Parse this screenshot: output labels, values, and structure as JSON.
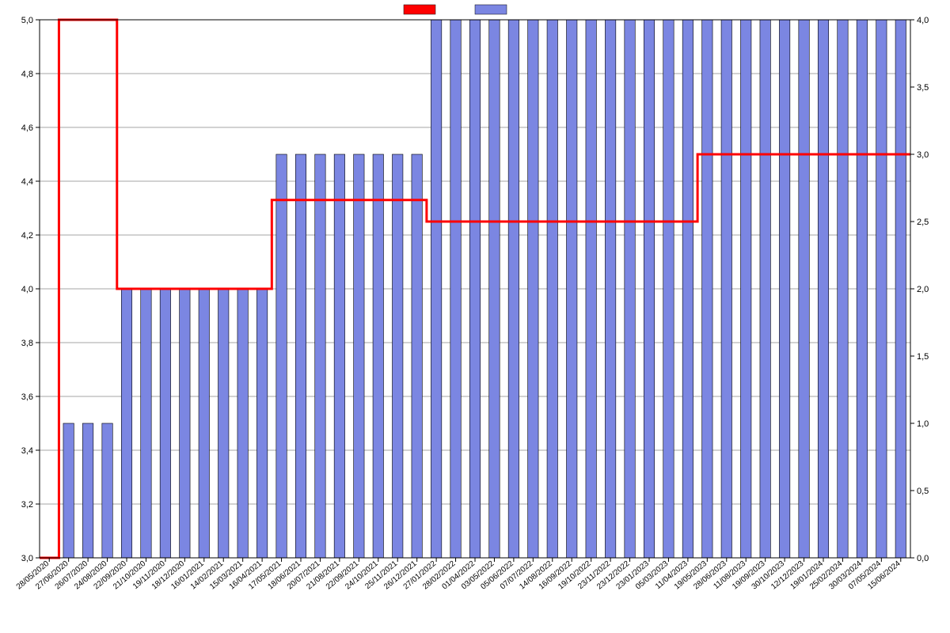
{
  "chart_data": {
    "type": "bar+line",
    "categories": [
      "28/05/2020",
      "27/06/2020",
      "26/07/2020",
      "24/08/2020",
      "22/09/2020",
      "21/10/2020",
      "19/11/2020",
      "18/12/2020",
      "16/01/2021",
      "14/02/2021",
      "15/03/2021",
      "16/04/2021",
      "17/05/2021",
      "18/06/2021",
      "20/07/2021",
      "21/08/2021",
      "22/09/2021",
      "24/10/2021",
      "25/11/2021",
      "26/12/2021",
      "27/01/2022",
      "28/02/2022",
      "01/04/2022",
      "03/05/2022",
      "05/06/2022",
      "07/07/2022",
      "14/08/2022",
      "16/09/2022",
      "19/10/2022",
      "23/11/2022",
      "23/12/2022",
      "23/01/2023",
      "05/03/2023",
      "11/04/2023",
      "19/05/2023",
      "28/06/2023",
      "11/08/2023",
      "19/09/2023",
      "30/10/2023",
      "12/12/2023",
      "19/01/2024",
      "25/02/2024",
      "30/03/2024",
      "07/05/2024",
      "15/06/2024"
    ],
    "series": [
      {
        "name": "",
        "role": "line",
        "axis": "left",
        "color": "#ff0000",
        "values": [
          3.0,
          5.0,
          5.0,
          5.0,
          4.0,
          4.0,
          4.0,
          4.0,
          4.0,
          4.0,
          4.0,
          4.0,
          4.33,
          4.33,
          4.33,
          4.33,
          4.33,
          4.33,
          4.33,
          4.33,
          4.25,
          4.25,
          4.25,
          4.25,
          4.25,
          4.25,
          4.25,
          4.25,
          4.25,
          4.25,
          4.25,
          4.25,
          4.25,
          4.25,
          4.5,
          4.5,
          4.5,
          4.5,
          4.5,
          4.5,
          4.5,
          4.5,
          4.5,
          4.5,
          4.5
        ]
      },
      {
        "name": "",
        "role": "bar",
        "axis": "right",
        "color": "#7b86e2",
        "values": [
          0,
          1.0,
          1.0,
          1.0,
          2.0,
          2.0,
          2.0,
          2.0,
          2.0,
          2.0,
          2.0,
          2.0,
          3.0,
          3.0,
          3.0,
          3.0,
          3.0,
          3.0,
          3.0,
          3.0,
          4.0,
          4.0,
          4.0,
          4.0,
          4.0,
          4.0,
          4.0,
          4.0,
          4.0,
          4.0,
          4.0,
          4.0,
          4.0,
          4.0,
          4.0,
          4.0,
          4.0,
          4.0,
          4.0,
          4.0,
          4.0,
          4.0,
          4.0,
          4.0,
          4.0
        ]
      }
    ],
    "y_left": {
      "min": 3.0,
      "max": 5.0,
      "ticks": [
        3.0,
        3.2,
        3.4,
        3.6,
        3.8,
        4.0,
        4.2,
        4.4,
        4.6,
        4.8,
        5.0
      ],
      "tick_labels": [
        "3,0",
        "3,2",
        "3,4",
        "3,6",
        "3,8",
        "4,0",
        "4,2",
        "4,4",
        "4,6",
        "4,8",
        "5,0"
      ]
    },
    "y_right": {
      "min": 0.0,
      "max": 4.0,
      "ticks": [
        0.0,
        0.5,
        1.0,
        1.5,
        2.0,
        2.5,
        3.0,
        3.5,
        4.0
      ],
      "tick_labels": [
        "0,0",
        "0,5",
        "1,0",
        "1,5",
        "2,0",
        "2,5",
        "3,0",
        "3,5",
        "4,0"
      ]
    },
    "grid": true,
    "xlabel": "",
    "ylabel_left": "",
    "ylabel_right": "",
    "title": "",
    "legend_position": "top"
  },
  "legend": {
    "line_label": "",
    "bar_label": ""
  }
}
